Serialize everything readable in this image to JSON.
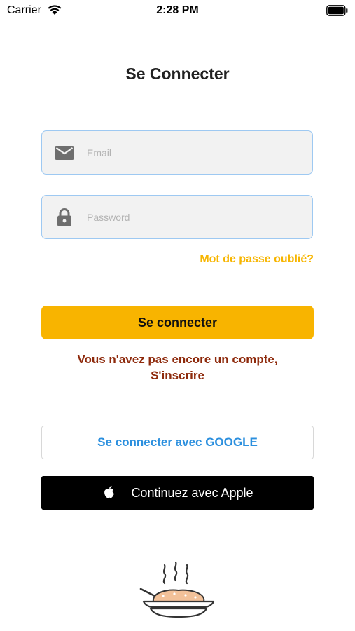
{
  "status_bar": {
    "carrier": "Carrier",
    "time": "2:28 PM",
    "icons": [
      "wifi-icon",
      "battery-icon"
    ]
  },
  "title": "Se Connecter",
  "form": {
    "email": {
      "placeholder": "Email",
      "value": "",
      "icon": "mail-icon"
    },
    "password": {
      "placeholder": "Password",
      "value": "",
      "icon": "lock-icon"
    },
    "forgot_label": "Mot de passe oublié?",
    "submit_label": "Se connecter"
  },
  "signup": {
    "line1": "Vous n'avez pas encore un compte,",
    "line2": "S'inscrire"
  },
  "social": {
    "google_label": "Se connecter avec GOOGLE",
    "apple_label": "Continuez avec Apple",
    "apple_icon": "apple-icon"
  },
  "footer": {
    "logo_icon": "food-bowl-icon"
  },
  "colors": {
    "accent": "#f8b400",
    "field_border": "#9ec9f2",
    "signup_text": "#8e2a0c",
    "google_text": "#2b8fde",
    "apple_bg": "#000000"
  }
}
